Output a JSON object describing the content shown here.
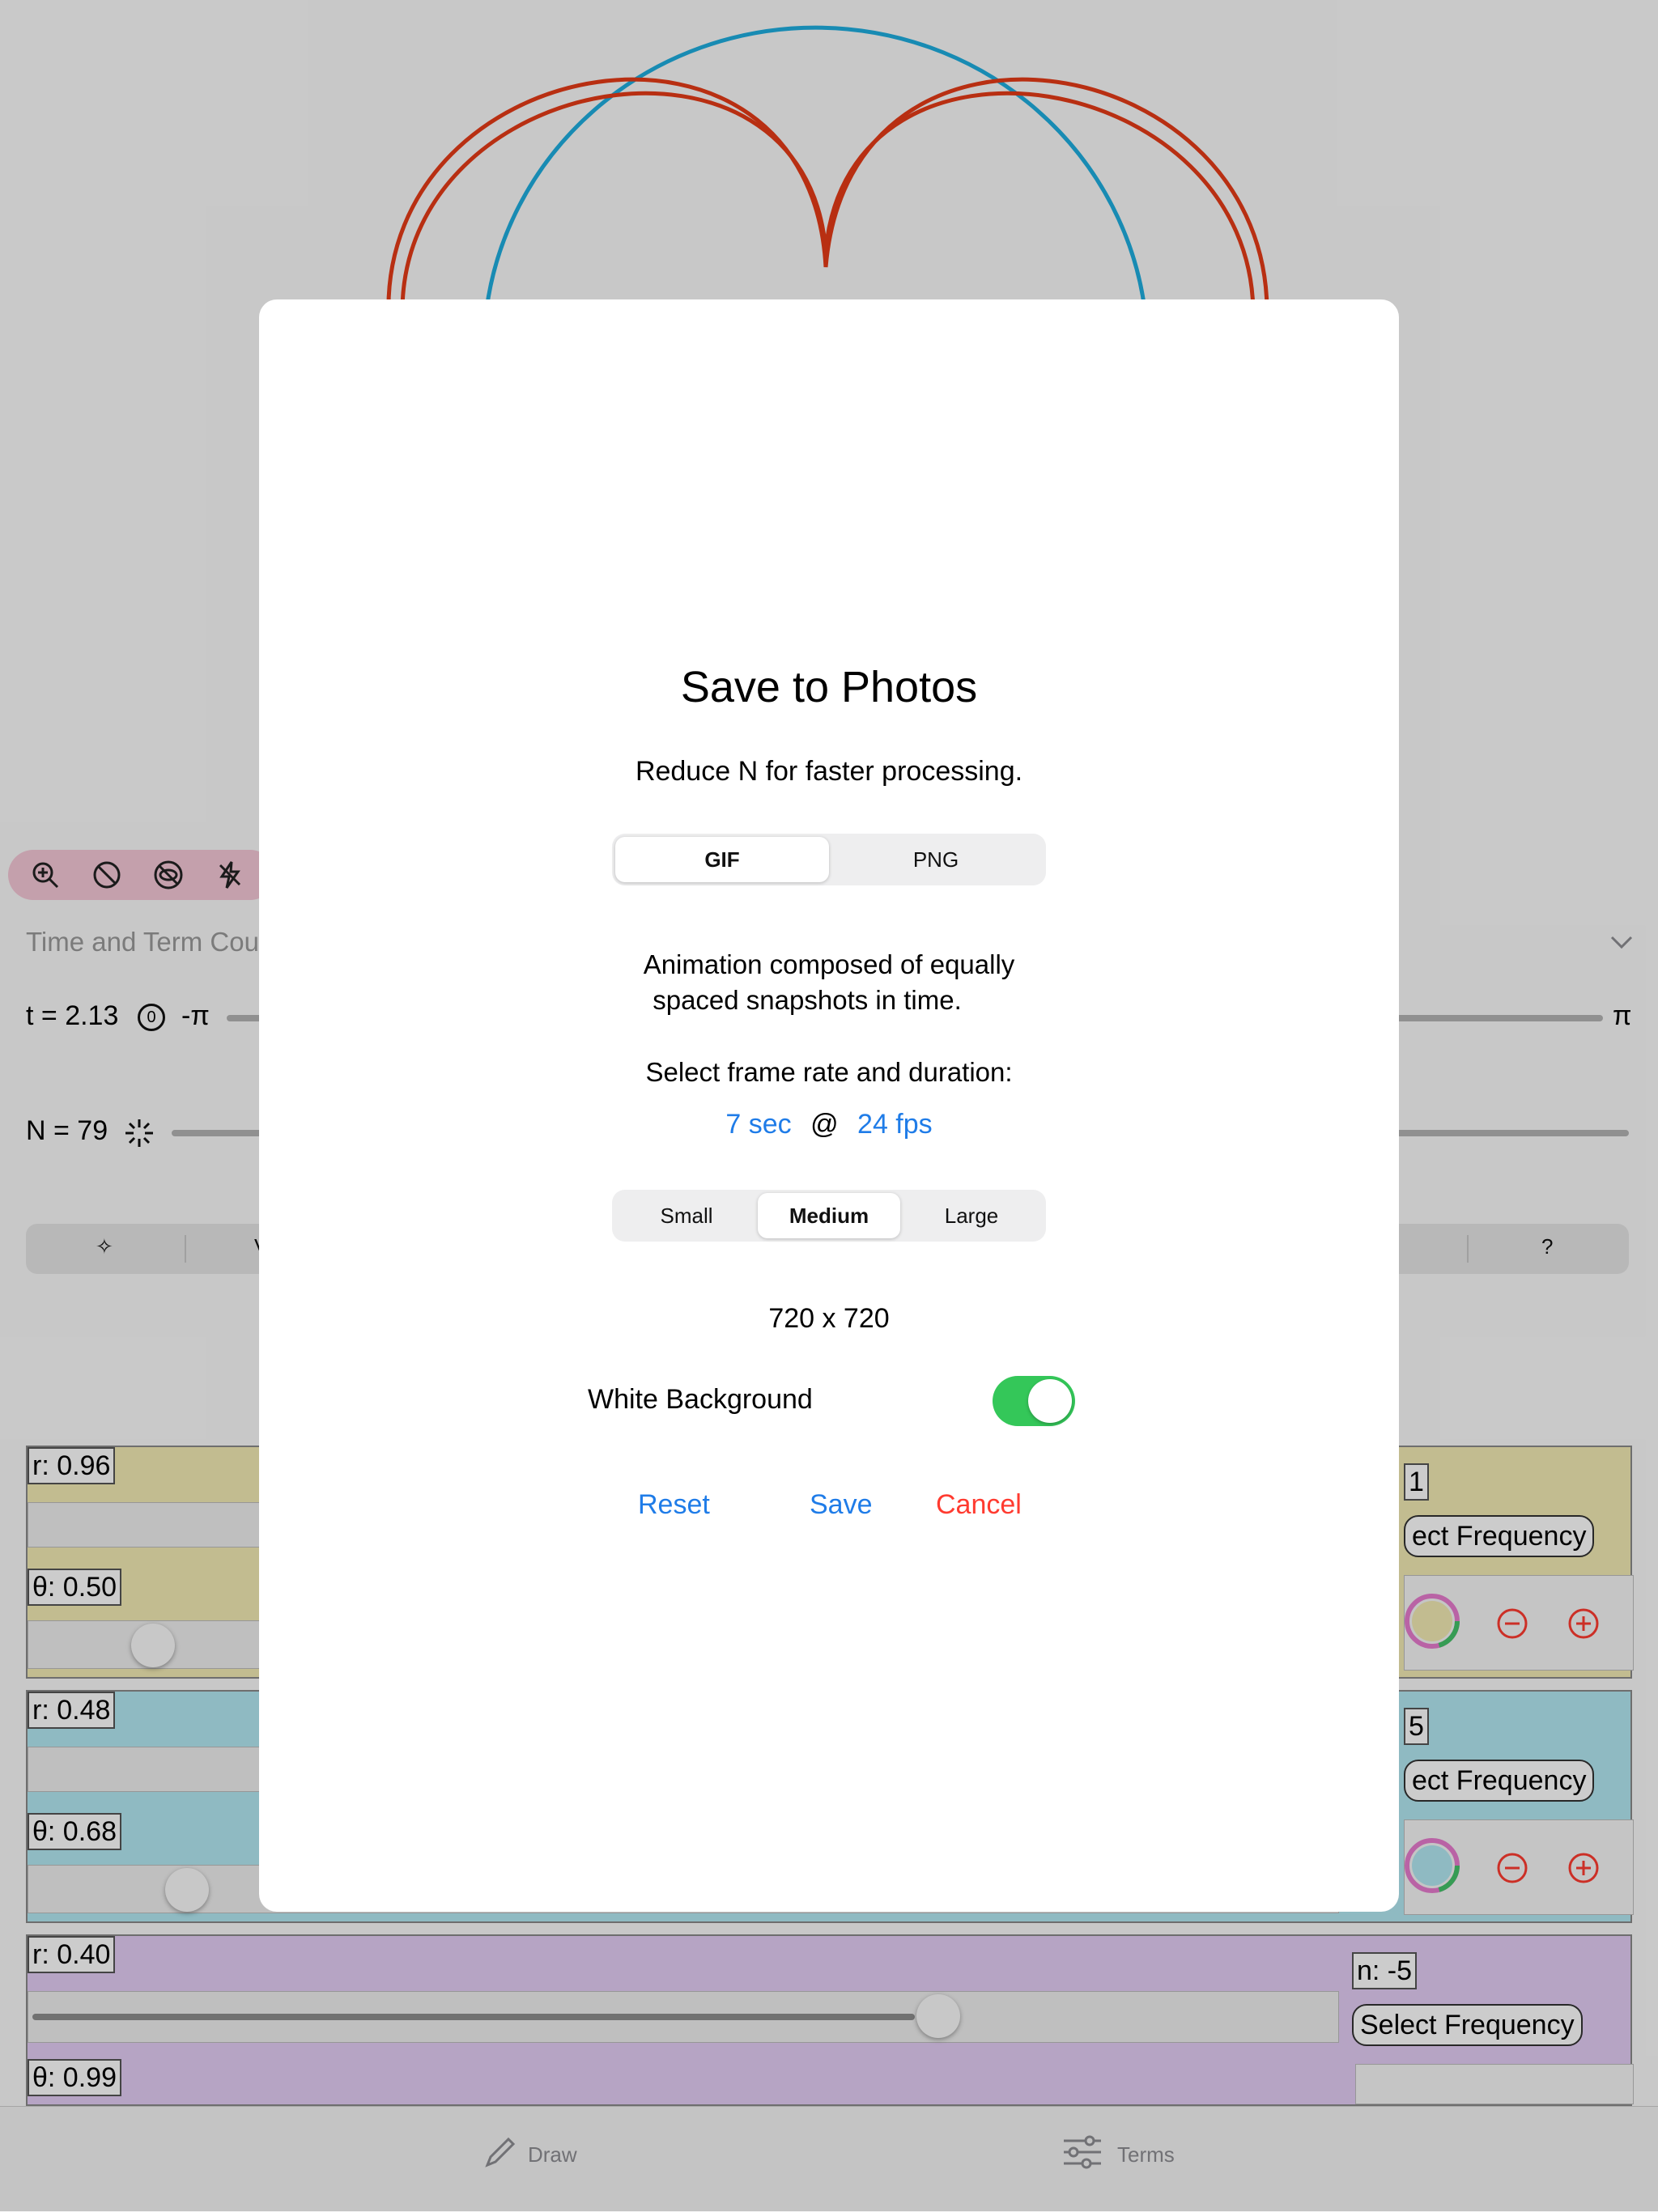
{
  "background_app": {
    "toolbar": {
      "icons": [
        "zoom-in-icon",
        "no-circle-icon",
        "hide-eye-icon",
        "flash-off-icon"
      ]
    },
    "section_title": "Time and Term Cou",
    "t_row": {
      "label": "t = 2.13",
      "reset_glyph": "0",
      "min_label": "-π",
      "max_label": "π"
    },
    "n_row": {
      "label": "N = 79"
    },
    "segments": {
      "first": "✧",
      "second": "V",
      "last": "?"
    },
    "terms": [
      {
        "r_label": "r: 0.96",
        "theta_label": "θ: 0.50",
        "n_label": "1",
        "freq_button": "ect Frequency"
      },
      {
        "r_label": "r: 0.48",
        "theta_label": "θ: 0.68",
        "n_label": "5",
        "freq_button": "ect Frequency"
      },
      {
        "r_label": "r: 0.40",
        "theta_label": "θ: 0.99",
        "n_label": "n: -5",
        "freq_button": "Select Frequency"
      }
    ],
    "tabbar": {
      "draw": "Draw",
      "terms": "Terms"
    },
    "colors": {
      "red_curve": "#e63b17",
      "blue_curve": "#1eaee0",
      "toggle_on": "#34c759",
      "link": "#1f7ce8",
      "destructive": "#ff3b30"
    }
  },
  "modal": {
    "title": "Save to Photos",
    "subtitle": "Reduce N for faster processing.",
    "format": {
      "options": [
        "GIF",
        "PNG"
      ],
      "selected": "GIF"
    },
    "description_line1": "Animation composed of equally",
    "description_line2": "spaced snapshots in time.",
    "frame_prompt": "Select frame rate and duration:",
    "duration": "7 sec",
    "at": "@",
    "fps": "24 fps",
    "size": {
      "options": [
        "Small",
        "Medium",
        "Large"
      ],
      "selected": "Medium"
    },
    "dimensions": "720 x 720",
    "white_background": {
      "label": "White Background",
      "on": true
    },
    "actions": {
      "reset": "Reset",
      "save": "Save",
      "cancel": "Cancel"
    }
  }
}
